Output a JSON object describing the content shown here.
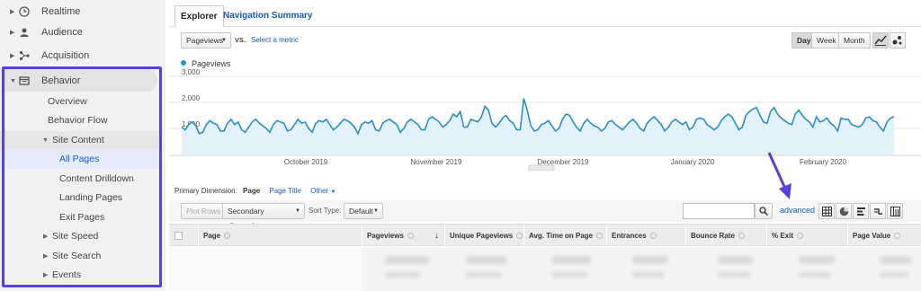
{
  "sidebar": {
    "top_items": [
      {
        "label": "Realtime",
        "icon": "clock-icon"
      },
      {
        "label": "Audience",
        "icon": "person-icon"
      },
      {
        "label": "Acquisition",
        "icon": "acquisition-icon"
      }
    ],
    "behavior": {
      "label": "Behavior",
      "icon": "behavior-icon"
    },
    "behavior_items": [
      {
        "label": "Overview"
      },
      {
        "label": "Behavior Flow"
      },
      {
        "label": "Site Content"
      },
      {
        "label": "All Pages"
      },
      {
        "label": "Content Drilldown"
      },
      {
        "label": "Landing Pages"
      },
      {
        "label": "Exit Pages"
      },
      {
        "label": "Site Speed"
      },
      {
        "label": "Site Search"
      },
      {
        "label": "Events"
      }
    ],
    "highlight_color": "#5b3fd9"
  },
  "tabs": {
    "explorer": "Explorer",
    "navigation_summary": "Navigation Summary"
  },
  "toolbar": {
    "metric_select": "Pageviews",
    "vs_label": "VS.",
    "select_metric_link": "Select a metric",
    "periods": [
      "Day",
      "Week",
      "Month"
    ],
    "active_period": "Day"
  },
  "chart": {
    "legend": "Pageviews",
    "y_ticks": [
      "3,000",
      "2,000",
      "1,000"
    ],
    "x_labels": [
      "October 2019",
      "November 2019",
      "December 2019",
      "January 2020",
      "February 2020"
    ],
    "line_color": "#2a8fcc",
    "fill_color": "#e3f1fa"
  },
  "chart_data": {
    "type": "area",
    "title": "",
    "series": [
      {
        "name": "Pageviews",
        "values": [
          1050,
          950,
          1150,
          1250,
          1100,
          800,
          850,
          1150,
          1300,
          1200,
          1150,
          900,
          900,
          1200,
          1350,
          1150,
          1250,
          950,
          850,
          1050,
          1250,
          1350,
          1200,
          1100,
          1000,
          850,
          1150,
          1300,
          1250,
          1200,
          900,
          950,
          1150,
          1350,
          1200,
          1250,
          1000,
          850,
          1200,
          1300,
          1250,
          1350,
          1150,
          950,
          1050,
          1200,
          1350,
          1300,
          1200,
          1050,
          800,
          1150,
          1250,
          1200,
          1300,
          950,
          900,
          1200,
          1300,
          1350,
          1250,
          1150,
          850,
          1000,
          1250,
          1350,
          1250,
          1150,
          950,
          950,
          1350,
          1450,
          1350,
          1250,
          1050,
          1150,
          1300,
          1550,
          1450,
          1650,
          1050,
          1050,
          1350,
          1300,
          1250,
          1450,
          1850,
          1700,
          1200,
          1050,
          1200,
          1400,
          1500,
          1300,
          1200,
          950,
          950,
          2150,
          1700,
          1100,
          900,
          950,
          1150,
          1200,
          1300,
          1100,
          900,
          1000,
          1350,
          1550,
          1500,
          1250,
          1050,
          900,
          1200,
          1350,
          1200,
          1100,
          1050,
          900,
          1000,
          1250,
          1300,
          1150,
          1050,
          950,
          1100,
          1250,
          1350,
          1200,
          1000,
          900,
          1200,
          1350,
          1450,
          1300,
          1150,
          900,
          1050,
          1250,
          1350,
          1250,
          1150,
          1250,
          950,
          1050,
          1350,
          1400,
          1350,
          1150,
          1050,
          950,
          1050,
          1300,
          1450,
          1550,
          1450,
          1200,
          950,
          1050,
          1500,
          1650,
          1750,
          1800,
          1500,
          1250,
          1200,
          1650,
          1800,
          1550,
          1400,
          1300,
          1200,
          1150,
          1550,
          1700,
          1500,
          1350,
          1250,
          1050,
          1450,
          1250,
          1300,
          1400,
          1200,
          1100,
          900,
          1400,
          1350,
          1350,
          1150,
          1100,
          1050,
          1150,
          1400,
          1450,
          1300,
          1250,
          1050,
          900,
          1250,
          1400,
          1450
        ]
      }
    ],
    "x_labels": [
      "October 2019",
      "November 2019",
      "December 2019",
      "January 2020",
      "February 2020"
    ],
    "y_ticks": [
      1000,
      2000,
      3000
    ],
    "ylim": [
      0,
      3000
    ],
    "grid": true,
    "legend_position": "top-left"
  },
  "dimension_bar": {
    "label": "Primary Dimension:",
    "active": "Page",
    "options": [
      "Page Title",
      "Other"
    ]
  },
  "controls": {
    "plot_rows": "Plot Rows",
    "secondary_dimension": "Secondary dimension",
    "sort_type_label": "Sort Type:",
    "sort_type_value": "Default",
    "advanced": "advanced"
  },
  "table": {
    "columns": [
      "Page",
      "Pageviews",
      "Unique Pageviews",
      "Avg. Time on Page",
      "Entrances",
      "Bounce Rate",
      "% Exit",
      "Page Value"
    ]
  },
  "annotation": {
    "arrow_color": "#5b3fd9"
  }
}
